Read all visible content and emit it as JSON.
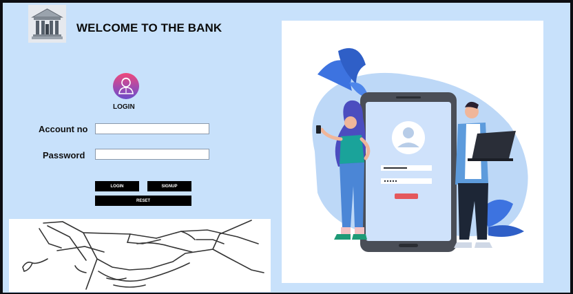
{
  "header": {
    "title": "WELCOME TO THE BANK",
    "logo_icon": "bank-building-icon"
  },
  "login_form": {
    "avatar_icon": "user-avatar-icon",
    "caption": "LOGIN",
    "account_label": "Account no",
    "account_value": "",
    "password_label": "Password",
    "password_value": ""
  },
  "buttons": {
    "login": "LOGIN",
    "signup": "SIGNUP",
    "reset": "RESET"
  },
  "images": {
    "handshake_icon": "handshake-sketch-icon",
    "illustration_icon": "mobile-login-illustration-icon"
  },
  "colors": {
    "background": "#c8e1fb",
    "button": "#000000",
    "accent": "#e4585c"
  }
}
